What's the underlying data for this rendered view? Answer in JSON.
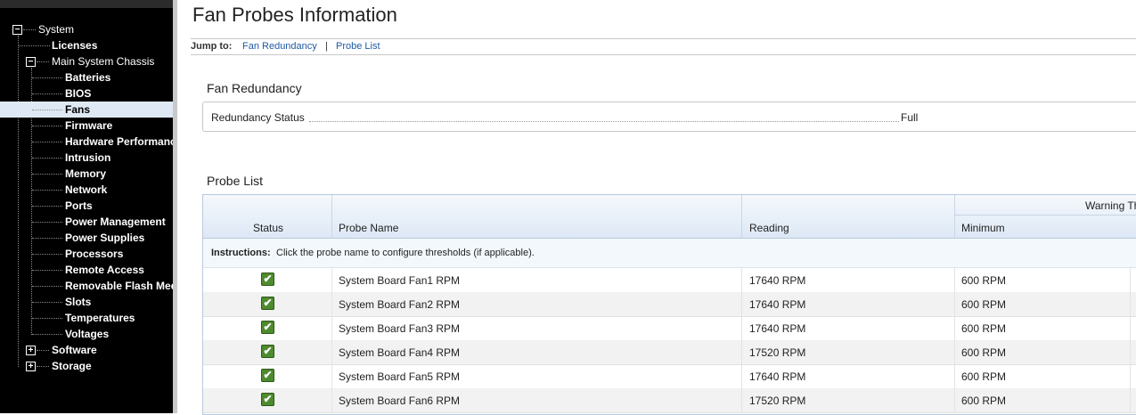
{
  "sidebar": {
    "items": [
      {
        "label": "System"
      },
      {
        "label": "Licenses"
      },
      {
        "label": "Main System Chassis"
      },
      {
        "label": "Batteries"
      },
      {
        "label": "BIOS"
      },
      {
        "label": "Fans"
      },
      {
        "label": "Firmware"
      },
      {
        "label": "Hardware Performanc"
      },
      {
        "label": "Intrusion"
      },
      {
        "label": "Memory"
      },
      {
        "label": "Network"
      },
      {
        "label": "Ports"
      },
      {
        "label": "Power Management"
      },
      {
        "label": "Power Supplies"
      },
      {
        "label": "Processors"
      },
      {
        "label": "Remote Access"
      },
      {
        "label": "Removable Flash Med"
      },
      {
        "label": "Slots"
      },
      {
        "label": "Temperatures"
      },
      {
        "label": "Voltages"
      },
      {
        "label": "Software"
      },
      {
        "label": "Storage"
      }
    ],
    "selected": "Fans",
    "collapse_symbol": "−",
    "expand_symbol": "+"
  },
  "page": {
    "title": "Fan Probes Information",
    "jump_label": "Jump to:",
    "jump_links": [
      "Fan Redundancy",
      "Probe List"
    ],
    "jump_separator": "|"
  },
  "redundancy": {
    "section_title": "Fan Redundancy",
    "status_label": "Redundancy Status",
    "status_value": "Full"
  },
  "probe_list": {
    "section_title": "Probe List",
    "group_header": "Warning Th",
    "columns": [
      "Status",
      "Probe Name",
      "Reading",
      "Minimum"
    ],
    "instructions_bold": "Instructions:",
    "instructions_text": " Click the probe name to configure thresholds (if applicable).",
    "status_icon": "check-icon",
    "status_color": "#4e8a2f",
    "rows": [
      {
        "name": "System Board Fan1 RPM",
        "reading": "17640 RPM",
        "minimum": "600 RPM"
      },
      {
        "name": "System Board Fan2 RPM",
        "reading": "17640 RPM",
        "minimum": "600 RPM"
      },
      {
        "name": "System Board Fan3 RPM",
        "reading": "17640 RPM",
        "minimum": "600 RPM"
      },
      {
        "name": "System Board Fan4 RPM",
        "reading": "17520 RPM",
        "minimum": "600 RPM"
      },
      {
        "name": "System Board Fan5 RPM",
        "reading": "17640 RPM",
        "minimum": "600 RPM"
      },
      {
        "name": "System Board Fan6 RPM",
        "reading": "17520 RPM",
        "minimum": "600 RPM"
      }
    ]
  }
}
